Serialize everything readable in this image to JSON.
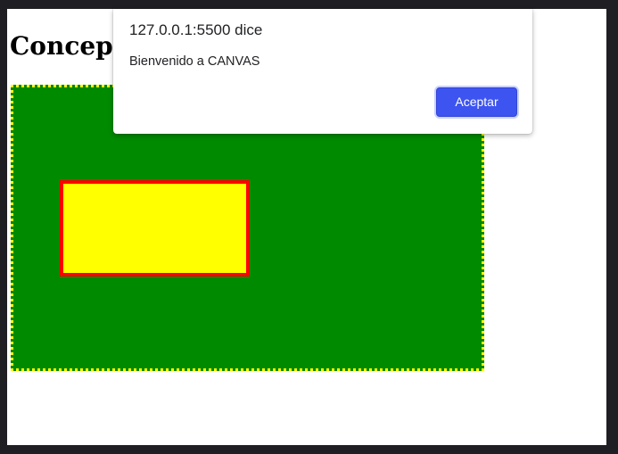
{
  "page": {
    "heading": "Concept"
  },
  "canvas": {
    "background_color": "#008a00",
    "border_color": "#ffff00",
    "rect_fill_color": "#ffff00",
    "rect_stroke_color": "#ff0000"
  },
  "alert_dialog": {
    "origin": "127.0.0.1:5500 dice",
    "message": "Bienvenido a CANVAS",
    "ok_label": "Aceptar",
    "accent_color": "#3d54f0"
  }
}
